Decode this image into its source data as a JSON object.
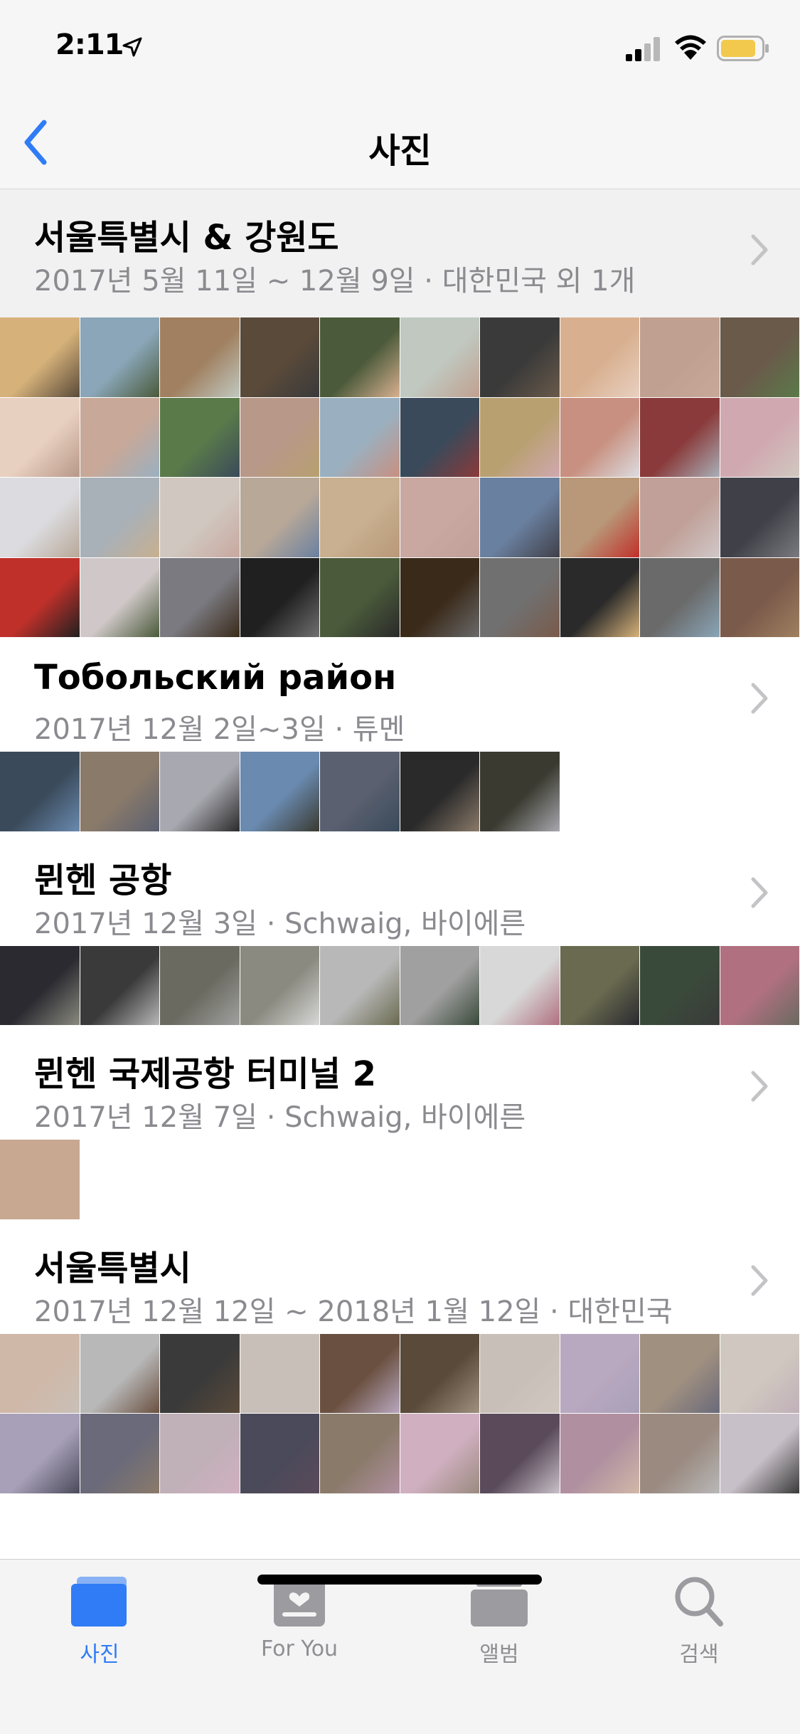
{
  "status": {
    "time": "2:11"
  },
  "nav": {
    "title": "사진"
  },
  "colors": {
    "accent": "#2f7cf6",
    "secondary_text": "#8a8a8f",
    "battery": "#f2c94c"
  },
  "moments": [
    {
      "title": "서울특별시 & 강원도",
      "subtitle": "2017년 5월 11일 ~ 12월 9일  ·  대한민국 외 1개",
      "rows": 4,
      "palette": [
        "#d6b27a",
        "#8aa6b8",
        "#a08060",
        "#5a4a3a",
        "#4a5a3a",
        "#c0c8c0",
        "#3a3a3a",
        "#d8b090",
        "#c0a090",
        "#6a5a4a",
        "#e8d0c0",
        "#c8a898",
        "#5a7a4a",
        "#b89888",
        "#9ab0c0",
        "#3a4a5a",
        "#b8a070",
        "#c89080",
        "#8a3a3a",
        "#d0a8b0",
        "#dcdce0",
        "#a8b0b8",
        "#d0c8c0",
        "#b8a898",
        "#c8b090",
        "#c8a8a0",
        "#6a80a0",
        "#b89878",
        "#c0a098",
        "#404048",
        "#c0302a",
        "#d0c8c8",
        "#7a7a80",
        "#202020",
        "#4a5a3a",
        "#3a2a1a",
        "#707070",
        "#2a2a2a",
        "#6a6a6a",
        "#7a5a4a"
      ]
    },
    {
      "title": "Тобольский район",
      "subtitle": "2017년 12월 2일~3일  ·  튜멘",
      "rows": 1,
      "palette": [
        "#3a4a5a",
        "#8a7a6a",
        "#a8a8b0",
        "#6a8ab0",
        "#5a6070",
        "#2a2a2a",
        "#3a3a30"
      ]
    },
    {
      "title": "뮌헨 공항",
      "subtitle": "2017년 12월 3일  ·  Schwaig, 바이에른",
      "rows": 1,
      "palette": [
        "#2a2a30",
        "#3a3a3a",
        "#6a6a60",
        "#8a8a80",
        "#b8b8b8",
        "#a0a0a0",
        "#d8d8d8",
        "#6a6a50",
        "#3a4a3a",
        "#b07080"
      ]
    },
    {
      "title": "뮌헨 국제공항 터미널 2",
      "subtitle": "2017년 12월 7일  ·  Schwaig, 바이에른",
      "rows": 1,
      "palette": [
        "#c8a890"
      ]
    },
    {
      "title": "서울특별시",
      "subtitle": "2017년 12월 12일 ~ 2018년 1월 12일  ·  대한민국",
      "rows": 2,
      "palette": [
        "#d0b8a8",
        "#b8b8b8",
        "#3a3a3a",
        "#c8c0b8",
        "#6a5040",
        "#5a4a3a",
        "#c8c0b8",
        "#b8a8c0",
        "#a09080",
        "#d0c8c0",
        "#a8a0b8",
        "#6a6a7a",
        "#c0b0b8",
        "#4a4a5a",
        "#8a7a6a",
        "#d0b0c0",
        "#5a4a5a",
        "#b090a0",
        "#9a8a80",
        "#c8c0c8"
      ]
    }
  ],
  "tabs": [
    {
      "label": "사진",
      "icon": "photos-icon"
    },
    {
      "label": "For You",
      "icon": "for-you-icon"
    },
    {
      "label": "앨범",
      "icon": "albums-icon"
    },
    {
      "label": "검색",
      "icon": "search-icon"
    }
  ]
}
